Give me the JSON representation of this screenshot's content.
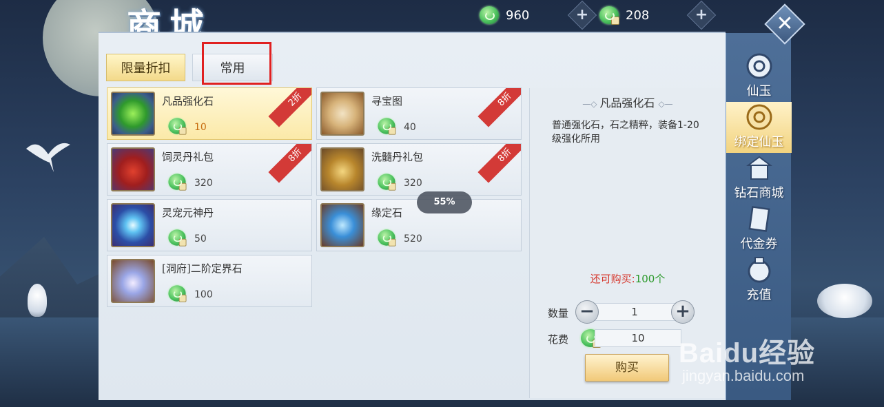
{
  "title": "商城",
  "currency": {
    "jade": "960",
    "bound_jade": "208"
  },
  "icons": {
    "close": "close-icon",
    "plus": "plus-icon"
  },
  "tabs": [
    {
      "label": "限量折扣",
      "active": true
    },
    {
      "label": "常用",
      "active": false
    }
  ],
  "items": [
    {
      "name": "凡品强化石",
      "price": "10",
      "badge": "2折",
      "selected": true
    },
    {
      "name": "寻宝图",
      "price": "40",
      "badge": "8折"
    },
    {
      "name": "饲灵丹礼包",
      "price": "320",
      "badge": "8折"
    },
    {
      "name": "洗髓丹礼包",
      "price": "320",
      "badge": "8折"
    },
    {
      "name": "灵宠元神丹",
      "price": "50",
      "badge": ""
    },
    {
      "name": "缘定石",
      "price": "520",
      "badge": ""
    },
    {
      "name": "[洞府]二阶定界石",
      "price": "100",
      "badge": ""
    }
  ],
  "progress": "55%",
  "detail": {
    "title": "凡品强化石",
    "description": "普通强化石，石之精粹，装备1-20级强化所用",
    "remain_label": "还可购买:",
    "remain_value": "100个",
    "quantity_label": "数量",
    "quantity": "1",
    "cost_label": "花费",
    "cost": "10",
    "buy_label": "购买"
  },
  "sidebar": [
    {
      "label": "仙玉"
    },
    {
      "label": "绑定仙玉",
      "active": true
    },
    {
      "label": "钻石商城"
    },
    {
      "label": "代金券"
    },
    {
      "label": "充值"
    }
  ],
  "watermark": {
    "main": "Baidu经验",
    "sub": "jingyan.baidu.com"
  }
}
